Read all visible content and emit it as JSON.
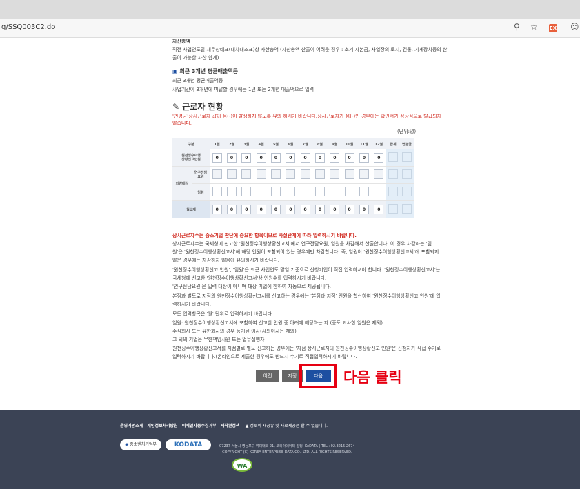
{
  "browser": {
    "url": "q/SSQ003C2.do",
    "zoom_icon": "zoom-icon",
    "favorite_icon": "favorite-star-icon",
    "extension_label": "EX",
    "profile_icon": "profile-icon"
  },
  "section_asset": {
    "title": "자산총액",
    "desc": "직전 사업연도말 재무상태표(대차대조표)상 자산총액 (자산총액 산출이 어려운 경우 : 초기 자본금, 사업장의 토지, 건물, 기계장치등의 산",
    "desc2": "출이 가능한 자산 합계)"
  },
  "section_sales": {
    "title": "최근 3개년 평균매출액등",
    "desc": "최근 3개년 평균매출액등",
    "desc2": "사업기간이 3개년에 미달할 경우에는 1년 또는 2개년 매출액으로 입력"
  },
  "workers": {
    "heading": "근로자 현황",
    "warning": "'연평균'상시근로자 값이 음(-)이 발생하지 않도록 유의 하시기 바랍니다.상시근로자가 음(-)인 경우에는 확인서가 정상적으로 발급되지",
    "warning2": "않습니다.",
    "unit": "(단위:명)"
  },
  "table": {
    "col_header": "구분",
    "months": [
      "1월",
      "2월",
      "3월",
      "4월",
      "5월",
      "6월",
      "7월",
      "8월",
      "9월",
      "10월",
      "11월",
      "12월"
    ],
    "sum_header": "합계",
    "avg_header": "연평균",
    "rows": {
      "r1_label": "원천징수이행\n상황신고인원",
      "r1_values": [
        "0",
        "0",
        "0",
        "0",
        "0",
        "0",
        "0",
        "0",
        "0",
        "0",
        "0",
        "0"
      ],
      "excl_label": "차감대상",
      "r2_label": "연구전담\n요원",
      "r3_label": "임원",
      "r4_label": "월소계",
      "r4_values": [
        "0",
        "0",
        "0",
        "0",
        "0",
        "0",
        "0",
        "0",
        "0",
        "0",
        "0",
        "0"
      ]
    }
  },
  "notes": {
    "n0": "상시근로자수는 중소기업 판단에 중요한 항목이므로 사실관계에 따라 입력하시기 바랍니다.",
    "n1": "상시근로자수는 국세청에 신고한 '원천징수이행상황신고서'에서 연구전담요원, 임원을 차감해서 산출합니다. 이 경우 차감하는 '임",
    "n1b": "원'은 '원천징수이행상황신고서'에 해당 인원이 포함되어 있는 경우에만 차감합니다. 즉, 임원이 '원천징수이행상황신고서'에 포함되지",
    "n1c": "않은 경우에는 차감하지 않음에 유의하시기 바랍니다.",
    "n2": "'원천징수이행상황신고 인원', '임원'은 최근 사업연도 말일 기준으로 신청기업이 직접 입력하셔야 합니다. '원천징수이행상황신고서'는",
    "n2b": "국세청에 신고한 '원천징수이행상황신고서'상 인원수를 입력하시기 바랍니다.",
    "n3": "'연구전담요원'은 입력 대상이 아니며 대상 기업에 한하여 자동으로 제공됩니다.",
    "n4": "본점과 별도로 지점의 원천징수이행상황신고서를 신고하는 경우에는 '본점과 지점' 인원을 합산하여 '원천징수이행상황신고 인원'에 입",
    "n4b": "력하시기 바랍니다.",
    "n5": "모든 입력항목은 '월' 단위로 입력하시기 바랍니다.",
    "n6": "임원: 원천징수이행상황신고서에 포함하여 신고한 인원 중 아래에 해당하는 자 (중도 퇴사한 임원은 제외)",
    "n7": "주식회사 또는 유한회사의 경우 등기된 이사(사외이사는 제외)",
    "n8": "그 외의 기업은 무한책임사원 또는 업무집행자",
    "n9": "원천징수이행상황신고서를 지점별로 별도 신고하는 경우에는 '지점 상시근로자의 원천징수이행상황신고 인원'은 신청자가 직접 수기로",
    "n9b": "입력하시기 바랍니다.(온라인으로 제출한 경우에도 반드시 수기로 직접입력하시기 바랍니다."
  },
  "buttons": {
    "prev": "이전",
    "save": "저장",
    "next": "다음"
  },
  "annotation": {
    "text": "다음 클릭",
    "color": "#e60012"
  },
  "footer": {
    "links": [
      "운영기관소개",
      "개인정보처리방침",
      "이메일자동수집거부",
      "저작권정책"
    ],
    "notice": "정보의 재공유 및 자료제공은 할 수 없습니다.",
    "logo1": "중소벤처기업부",
    "logo2": "KODATA",
    "address": "07237 서울시 영등포구 여의대로 21, 코리아데이터 빌딩, KoDATA | TEL : 02.3215.2674",
    "copyright": "COPYRIGHT (C) KOREA ENTERPRISE DATA CO., LTD. ALL RIGHTS RESERVED.",
    "wa_mark": "WA"
  },
  "colors": {
    "footer_bg": "#3b4355",
    "next_btn": "#1d4fa1",
    "prev_btn": "#666666",
    "accent_red": "#d0281e"
  }
}
